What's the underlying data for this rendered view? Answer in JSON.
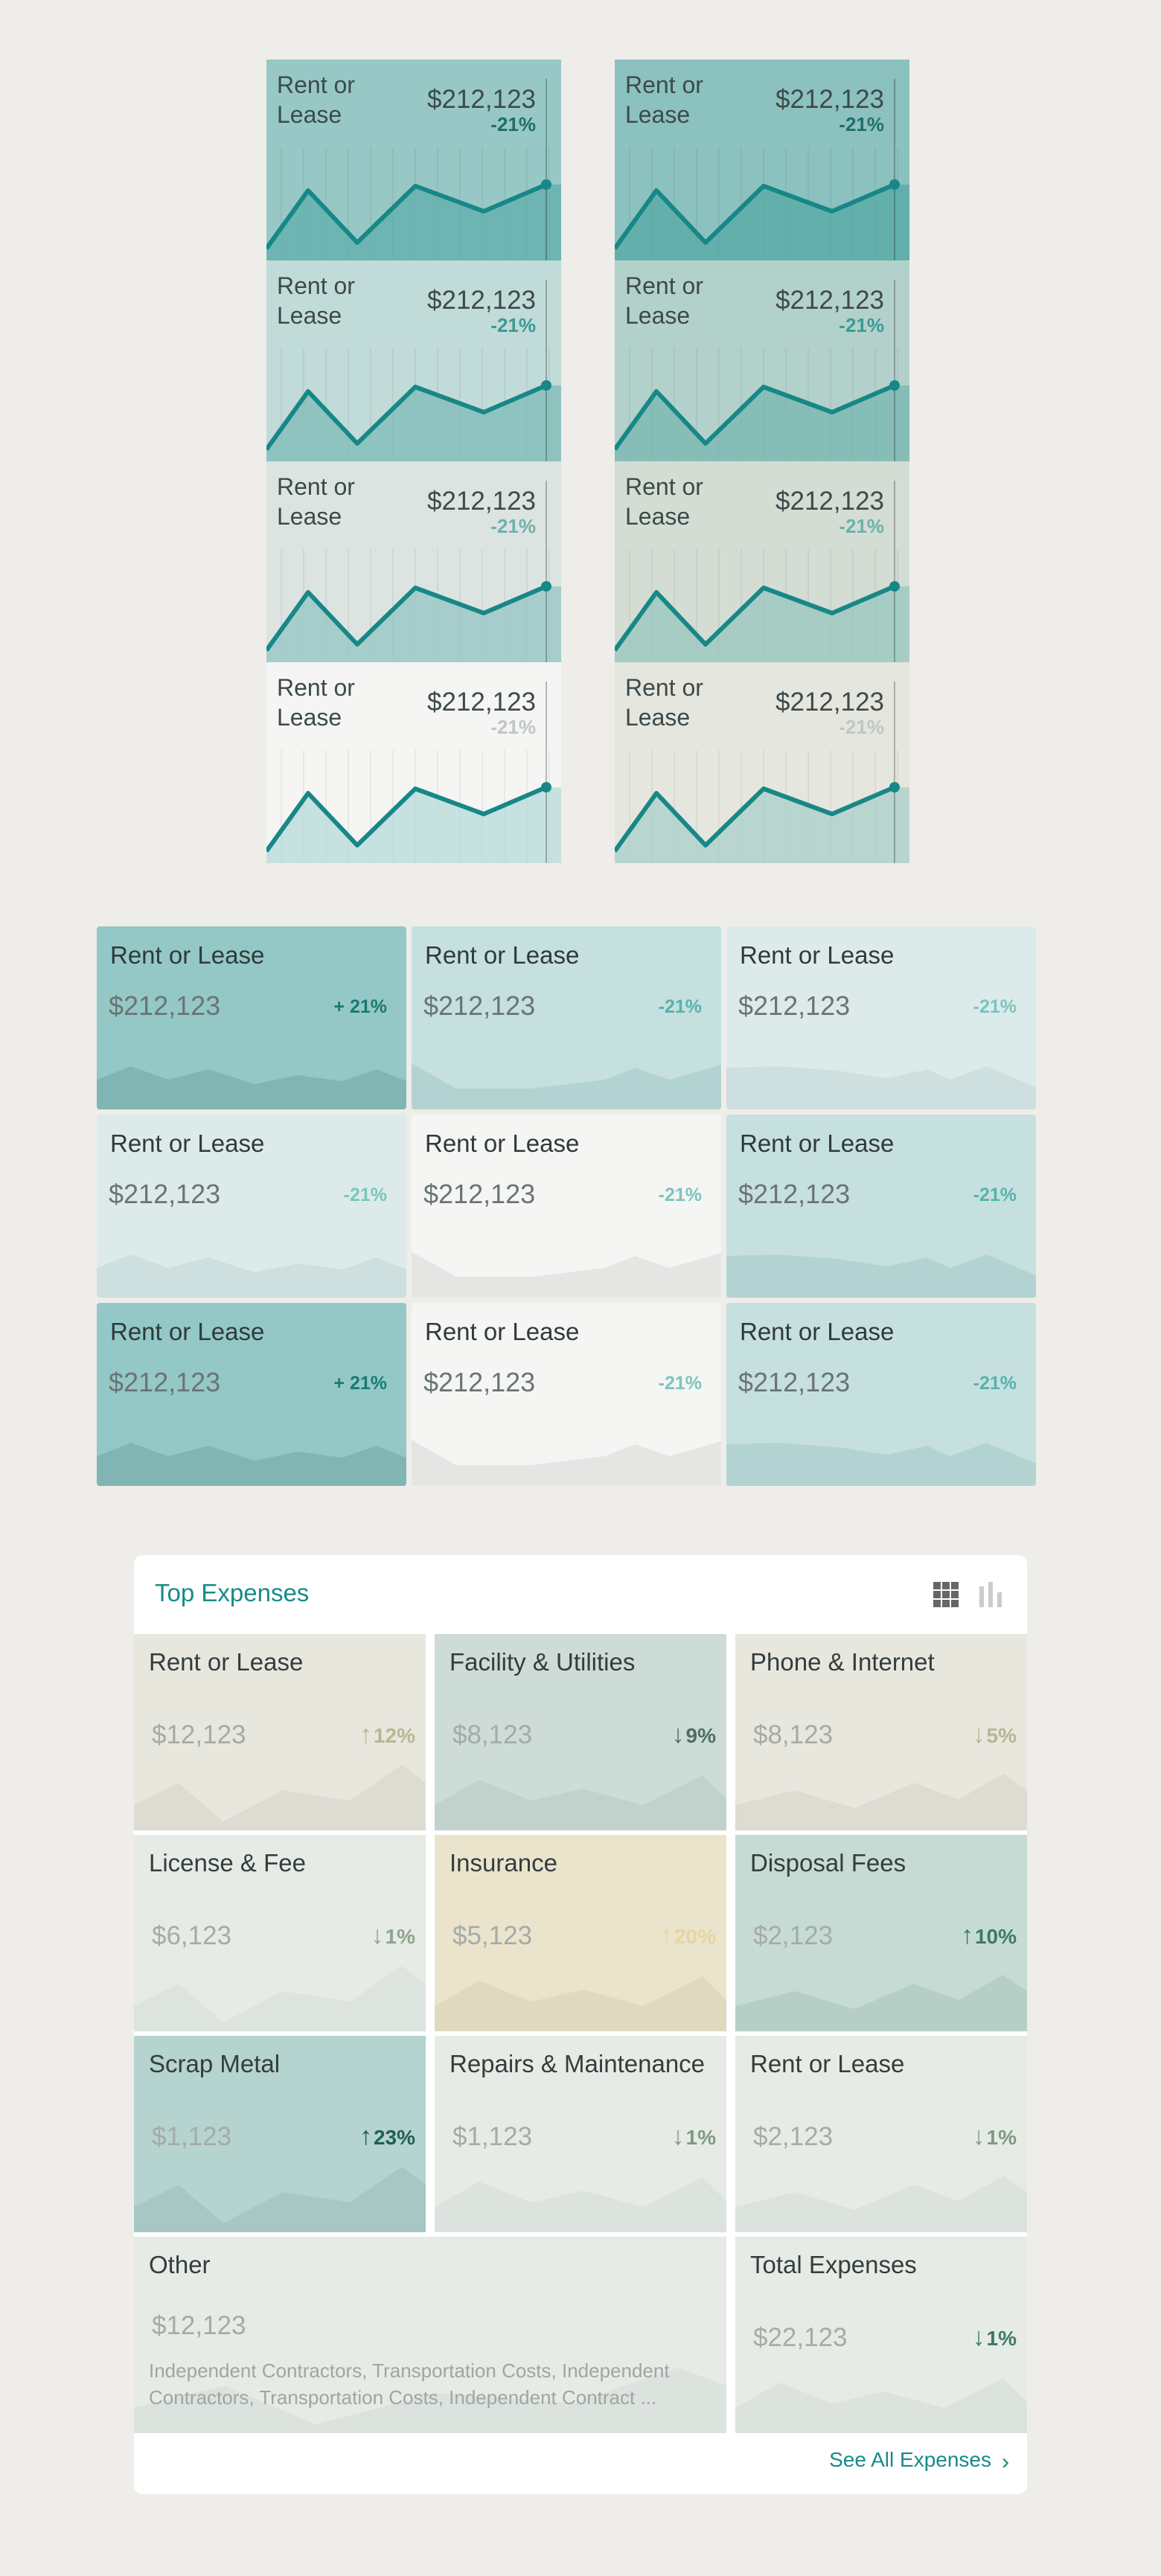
{
  "palette": {
    "line": "#178787",
    "teal_dark": "#1E8A80",
    "bg": "#EEEDE9"
  },
  "sparkline_tiles": {
    "label": "Rent or Lease",
    "label_line1": "Rent or",
    "label_line2": "Lease",
    "value": "$212,123",
    "change": "-21%",
    "columns": [
      {
        "tiles": [
          {
            "bg": "#97C8C5",
            "fill": "#5FAEAB",
            "pct_color": "#1F6E6B"
          },
          {
            "bg": "#C1DBD8",
            "fill": "#7EBBB8",
            "pct_color": "#3A9A96"
          },
          {
            "bg": "#DCE4E1",
            "fill": "#94C6C3",
            "pct_color": "#6FB0AC"
          },
          {
            "bg": "#F5F5F4",
            "fill": "#B6DAD8",
            "pct_color": "#BFC6C4"
          }
        ]
      },
      {
        "tiles": [
          {
            "bg": "#8BC1BF",
            "fill": "#55A8A6",
            "pct_color": "#1F6E6B"
          },
          {
            "bg": "#B3D1CB",
            "fill": "#78B5B0",
            "pct_color": "#3A9A96"
          },
          {
            "bg": "#D3DDD4",
            "fill": "#97C6BF",
            "pct_color": "#6FB0AC"
          },
          {
            "bg": "#E5E6DE",
            "fill": "#A9CFC9",
            "pct_color": "#BFC6C4"
          }
        ]
      }
    ]
  },
  "grid_tiles": {
    "label": "Rent or Lease",
    "value": "$212,123",
    "tiles": [
      {
        "change": "+ 21%",
        "bg": "#93C8C6",
        "fill": "#80B5B3",
        "pct_color": "#197A72"
      },
      {
        "change": "-21%",
        "bg": "#C6E0DF",
        "fill": "#B3D3D2",
        "pct_color": "#56B3AC"
      },
      {
        "change": "-21%",
        "bg": "#DCEBEA",
        "fill": "#CDDFDE",
        "pct_color": "#7CC5BE"
      },
      {
        "change": "-21%",
        "bg": "#DCEBEA",
        "fill": "#CDDFDE",
        "pct_color": "#7CC5BE"
      },
      {
        "change": "-21%",
        "bg": "#F5F5F4",
        "fill": "#E5E5E4",
        "pct_color": "#7CC5BE"
      },
      {
        "change": "-21%",
        "bg": "#C6E0DF",
        "fill": "#B3D3D2",
        "pct_color": "#56B3AC"
      },
      {
        "change": "+ 21%",
        "bg": "#93C8C6",
        "fill": "#80B5B3",
        "pct_color": "#197A72"
      },
      {
        "change": "-21%",
        "bg": "#F5F5F4",
        "fill": "#E5E5E4",
        "pct_color": "#7CC5BE"
      },
      {
        "change": "-21%",
        "bg": "#C6E0DF",
        "fill": "#B3D3D2",
        "pct_color": "#56B3AC"
      }
    ]
  },
  "top_expenses": {
    "title": "Top Expenses",
    "icons": [
      "grid-view-icon",
      "bar-chart-icon"
    ],
    "items": [
      {
        "label": "Rent or Lease",
        "value": "$12,123",
        "direction": "up",
        "change": "12%",
        "bg": "#E8E7DE",
        "fill": "#DDDCD2",
        "pct_color": "#B4B892"
      },
      {
        "label": "Facility & Utilities",
        "value": "$8,123",
        "direction": "down",
        "change": "9%",
        "bg": "#CDDCD6",
        "fill": "#C0D2CB",
        "pct_color": "#4E6E66"
      },
      {
        "label": "Phone & Internet",
        "value": "$8,123",
        "direction": "down",
        "change": "5%",
        "bg": "#E8E7DE",
        "fill": "#DDDCD2",
        "pct_color": "#B4B892"
      },
      {
        "label": "License & Fee",
        "value": "$6,123",
        "direction": "down",
        "change": "1%",
        "bg": "#E6EBE6",
        "fill": "#DDE3DE",
        "pct_color": "#8FA48F"
      },
      {
        "label": "Insurance",
        "value": "$5,123",
        "direction": "up",
        "change": "20%",
        "bg": "#EBE4CC",
        "fill": "#E1D9BF",
        "pct_color": "#E6D59F"
      },
      {
        "label": "Disposal Fees",
        "value": "$2,123",
        "direction": "up",
        "change": "10%",
        "bg": "#C6DBD3",
        "fill": "#B6CFC6",
        "pct_color": "#3C7A6A"
      },
      {
        "label": "Scrap Metal",
        "value": "$1,123",
        "direction": "up",
        "change": "23%",
        "bg": "#B5D3CF",
        "fill": "#A6C7C3",
        "pct_color": "#1F5F58"
      },
      {
        "label": "Repairs & Maintenance",
        "value": "$1,123",
        "direction": "down",
        "change": "1%",
        "bg": "#E6EBE6",
        "fill": "#DCE3DE",
        "pct_color": "#7F9A80"
      },
      {
        "label": "Rent or Lease",
        "value": "$2,123",
        "direction": "down",
        "change": "1%",
        "bg": "#E6EBE6",
        "fill": "#DCE3DE",
        "pct_color": "#7F9A80"
      },
      {
        "label": "Other",
        "value": "$12,123",
        "description": "Independent Contractors, Transportation Costs, Independent Contractors, Transportation Costs, Independent Contract  ...",
        "bg": "#E6EBE6",
        "fill": "#DCE3DE"
      },
      {
        "label": "Total Expenses",
        "value": "$22,123",
        "direction": "down",
        "change": "1%",
        "bg": "#E6EBE6",
        "fill": "#DCE3DE",
        "pct_color": "#3C7A6A"
      }
    ],
    "see_all": "See All Expenses"
  }
}
